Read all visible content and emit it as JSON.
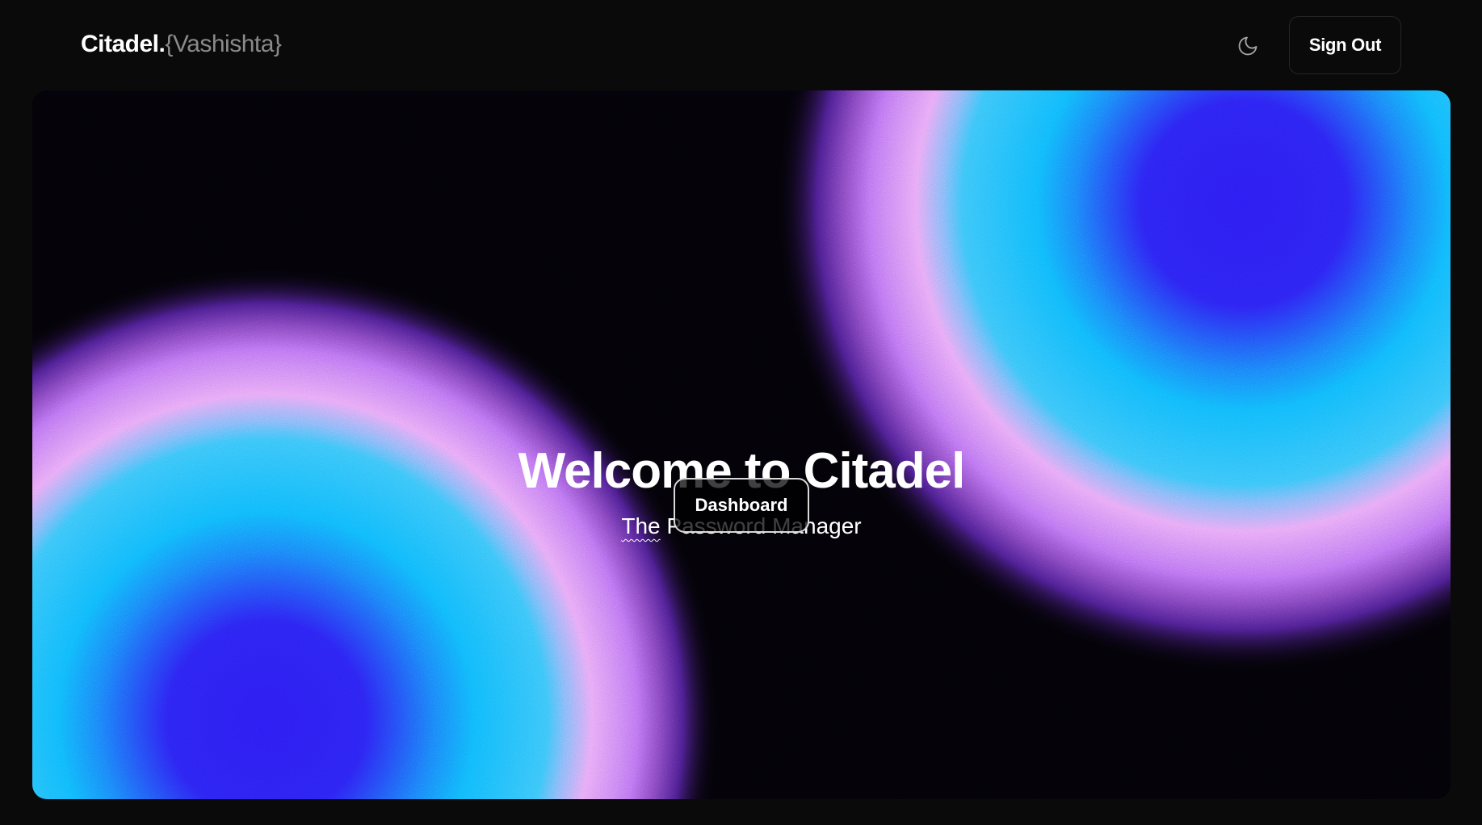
{
  "header": {
    "logo_main": "Citadel.",
    "logo_user": "{Vashishta}",
    "theme_icon": "moon-icon",
    "signout_label": "Sign Out"
  },
  "hero": {
    "title": "Welcome to Citadel",
    "subtitle_underlined": "The",
    "subtitle_rest": " Password Manager",
    "cta_label": "Dashboard"
  },
  "colors": {
    "page_bg": "#0a0a0a",
    "hero_bg": "#040208",
    "gradient_blue": "#2a1bf0",
    "gradient_cyan": "#10b4fb",
    "gradient_pink": "#e6a3f5",
    "gradient_purple": "#7a3ad8"
  }
}
